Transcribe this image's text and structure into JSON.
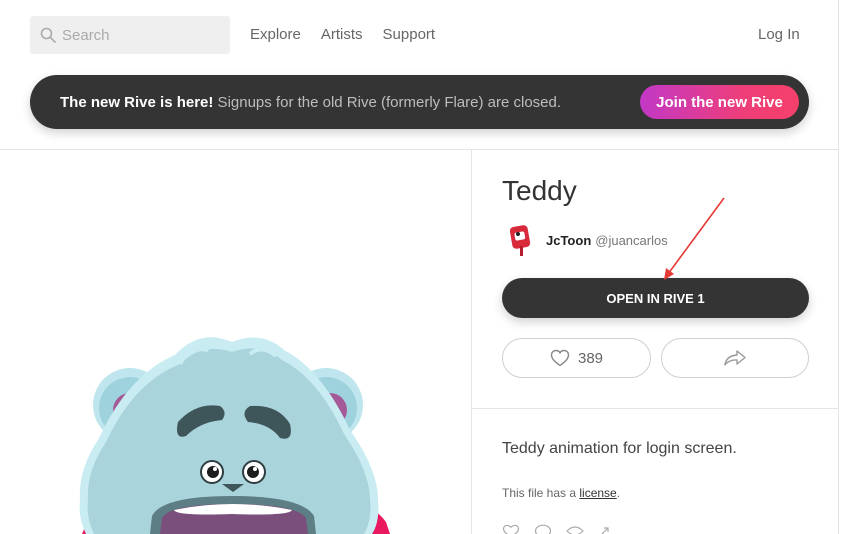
{
  "header": {
    "search_placeholder": "Search",
    "nav": [
      "Explore",
      "Artists",
      "Support"
    ],
    "login": "Log In"
  },
  "banner": {
    "bold_text": "The new Rive is here!",
    "text": " Signups for the old Rive (formerly Flare) are closed.",
    "button": "Join the new Rive"
  },
  "file": {
    "title": "Teddy",
    "author_name": "JcToon",
    "author_handle": "@juancarlos",
    "open_button": "OPEN IN RIVE 1",
    "likes": "389",
    "description": "Teddy animation for login screen.",
    "license_prefix": "This file has a ",
    "license_link": "license",
    "license_suffix": "."
  },
  "icons": {
    "search": "search-icon",
    "like": "heart-icon",
    "share": "share-icon",
    "avatar": "avatar-icon"
  },
  "colors": {
    "dark": "#343434",
    "accent_start": "#c238c6",
    "accent_end": "#f5406a",
    "annotation": "#e53935"
  }
}
